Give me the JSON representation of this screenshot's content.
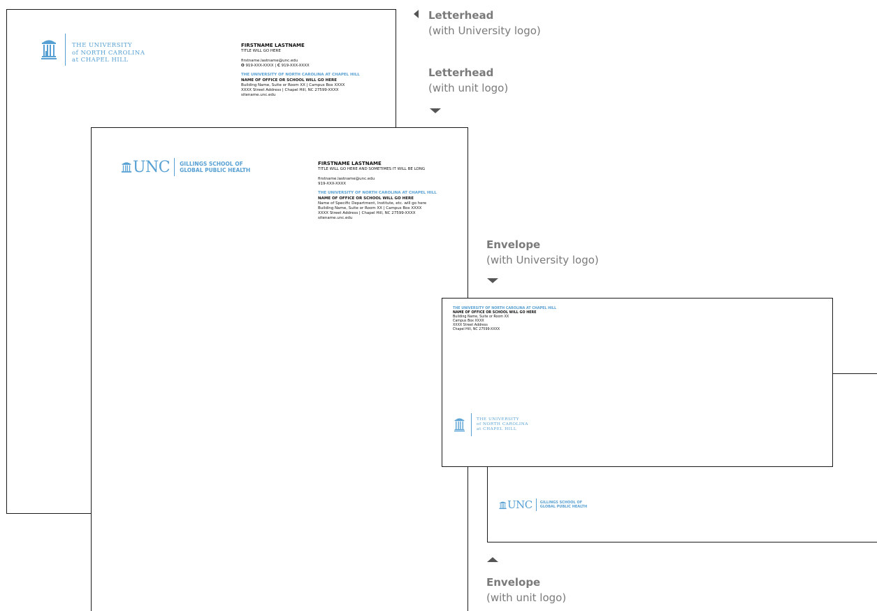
{
  "labels": {
    "letterhead_univ": {
      "title": "Letterhead",
      "sub": "(with University logo)"
    },
    "letterhead_unit": {
      "title": "Letterhead",
      "sub": "(with unit logo)"
    },
    "envelope_univ": {
      "title": "Envelope",
      "sub": "(with University logo)"
    },
    "envelope_unit": {
      "title": "Envelope",
      "sub": "(with unit logo)"
    }
  },
  "univ_logo": {
    "line1": "THE UNIVERSITY",
    "line2": "of NORTH CAROLINA",
    "line3": "at CHAPEL HILL"
  },
  "unit_logo": {
    "word": "UNC",
    "line1": "GILLINGS SCHOOL OF",
    "line2": "GLOBAL PUBLIC HEALTH"
  },
  "letterhead1": {
    "name": "FIRSTNAME LASTNAME",
    "title": "TITLE WILL GO HERE",
    "email": "firstname.lastname@unc.edu",
    "phone_o_label": "O",
    "phone_o": "919-XXX-XXXX",
    "sep": "|",
    "phone_c_label": "C",
    "phone_c": "919-XXX-XXXX",
    "univ": "THE UNIVERSITY OF NORTH CAROLINA AT CHAPEL HILL",
    "office": "NAME OF OFFICE OR SCHOOL WILL GO HERE",
    "addr1": "Building Name, Suite or Room XX  |  Campus Box XXXX",
    "addr2": "XXXX Street Address  |  Chapel Hill, NC 27599-XXXX",
    "site": "sitename.unc.edu"
  },
  "letterhead2": {
    "name": "FIRSTNAME LASTNAME",
    "title": "TITLE WILL GO HERE AND SOMETIMES IT WILL BE LONG",
    "email": "firstname.lastname@unc.edu",
    "phone": "919-XXX-XXXX",
    "univ": "THE UNIVERSITY OF NORTH CAROLINA AT CHAPEL HILL",
    "office": "NAME OF OFFICE OR SCHOOL WILL GO HERE",
    "dept": "Name of Specific Department, Institute, etc. will go here",
    "addr1": "Building Name, Suite or Room XX  |  Campus Box XXXX",
    "addr2": "XXXX Street Address  |  Chapel Hill, NC 27599-XXXX",
    "site": "sitename.unc.edu"
  },
  "envelope1": {
    "univ": "THE UNIVERSITY OF NORTH CAROLINA AT CHAPEL HILL",
    "office": "NAME OF OFFICE OR SCHOOL WILL GO HERE",
    "addr1": "Building Name, Suite or Room XX",
    "addr2": "Campus Box XXXX",
    "addr3": "XXXX Street Address",
    "addr4": "Chapel Hill, NC 27599-XXXX"
  },
  "colors": {
    "accent": "#57a0d3",
    "label": "#7a7a7a",
    "border": "#1a1a1a"
  }
}
